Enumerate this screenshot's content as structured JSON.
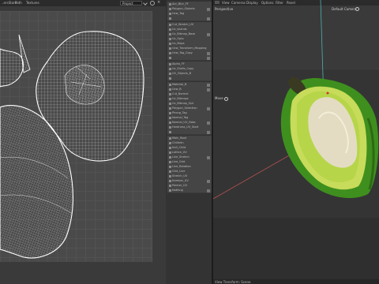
{
  "uv_editor": {
    "menu": [
      "..ersStore",
      "Path",
      "Textures"
    ],
    "project_select": "Project",
    "icon_labels": [
      "chevron-down-icon",
      "settings-icon",
      "close-icon"
    ]
  },
  "object_manager": {
    "rows": [
      "Acc_Blur_FF",
      "Polygon_Objects",
      "Uvw_Tag",
      "",
      "Cut_Stretch_UV",
      "Uv_Islands",
      "Uv_Bitmap_Base",
      "Uv_Opts",
      "Uv_Maps",
      "Uvw_Transform_Mapping",
      "Uvw_Tag_Copy",
      "",
      "Alpha_FF",
      "Uv_Shells_Copy",
      "UV_Objects_B",
      "",
      "Material_B",
      "Uvw_B",
      "Cut_Normal",
      "Uv_Bitmaps",
      "Uv_Bitmap_Opt",
      "Polygon_Selection",
      "Phong_Tag",
      "Normal_Tag",
      "Normal_UV_Data",
      "Hardness_UV_Start",
      "",
      "Main_Root",
      "Children",
      "Null_Child",
      "Lattice_UV",
      "Line_Stretch",
      "Line_Grid",
      "Line_Rotation",
      "Grid_Line",
      "Stretch_UV",
      "Number_UV",
      "Pointer_UV",
      "Nothing"
    ]
  },
  "viewport": {
    "menu": [
      "View",
      "Cameras",
      "Display",
      "Options",
      "Filter",
      "Panel"
    ],
    "view_name": "Perspective",
    "camera_label": "Default Camera",
    "move_label": "Move",
    "status": "View Transform: Scene"
  },
  "colors": {
    "uv_wire": "#ffffff",
    "grid_bg": "#4a4a4a",
    "avocado_skin": "#3f8f1e",
    "avocado_flesh": "#c7dc5a",
    "avocado_pit": "#e3dcc2",
    "axis_red": "#b05050",
    "axis_cyan": "#4fb0b0"
  }
}
